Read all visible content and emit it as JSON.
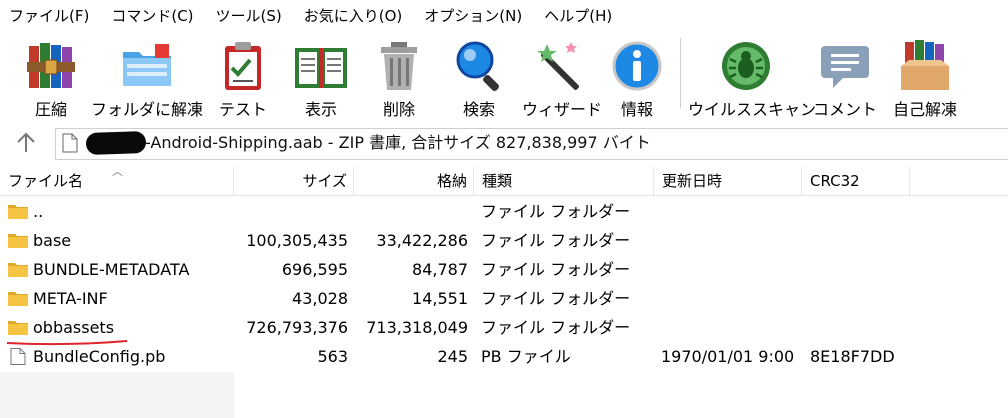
{
  "menu": [
    "ファイル(F)",
    "コマンド(C)",
    "ツール(S)",
    "お気に入り(O)",
    "オプション(N)",
    "ヘルプ(H)"
  ],
  "toolbar": {
    "buttons": [
      {
        "label": "圧縮",
        "icon": "books-compress-icon"
      },
      {
        "label": "フォルダに解凍",
        "icon": "folder-extract-icon"
      },
      {
        "label": "テスト",
        "icon": "clipboard-test-icon"
      },
      {
        "label": "表示",
        "icon": "open-book-icon"
      },
      {
        "label": "削除",
        "icon": "trash-can-icon"
      },
      {
        "label": "検索",
        "icon": "magnifier-icon"
      },
      {
        "label": "ウィザード",
        "icon": "magic-wand-icon"
      },
      {
        "label": "情報",
        "icon": "info-icon"
      },
      {
        "label": "ウイルススキャン",
        "icon": "virus-bug-icon"
      },
      {
        "label": "コメント",
        "icon": "comment-bubble-icon"
      },
      {
        "label": "自己解凍",
        "icon": "sfx-box-icon"
      }
    ]
  },
  "address": {
    "text": "-Android-Shipping.aab - ZIP 書庫, 合計サイズ 827,838,997 バイト"
  },
  "columns": {
    "name": "ファイル名",
    "size": "サイズ",
    "packed": "格納",
    "type": "種類",
    "modified": "更新日時",
    "crc": "CRC32"
  },
  "files": [
    {
      "name": "..",
      "size": "",
      "packed": "",
      "type": "ファイル フォルダー",
      "modified": "",
      "crc": "",
      "kind": "folder"
    },
    {
      "name": "base",
      "size": "100,305,435",
      "packed": "33,422,286",
      "type": "ファイル フォルダー",
      "modified": "",
      "crc": "",
      "kind": "folder"
    },
    {
      "name": "BUNDLE-METADATA",
      "size": "696,595",
      "packed": "84,787",
      "type": "ファイル フォルダー",
      "modified": "",
      "crc": "",
      "kind": "folder"
    },
    {
      "name": "META-INF",
      "size": "43,028",
      "packed": "14,551",
      "type": "ファイル フォルダー",
      "modified": "",
      "crc": "",
      "kind": "folder"
    },
    {
      "name": "obbassets",
      "size": "726,793,376",
      "packed": "713,318,049",
      "type": "ファイル フォルダー",
      "modified": "",
      "crc": "",
      "kind": "folder"
    },
    {
      "name": "BundleConfig.pb",
      "size": "563",
      "packed": "245",
      "type": "PB ファイル",
      "modified": "1970/01/01 9:00",
      "crc": "8E18F7DD",
      "kind": "file"
    }
  ],
  "colors": {
    "folder": "#f6c443",
    "folder_dark": "#e0a82a",
    "underline": "#e0242a",
    "accent_blue": "#2a7fd4"
  }
}
